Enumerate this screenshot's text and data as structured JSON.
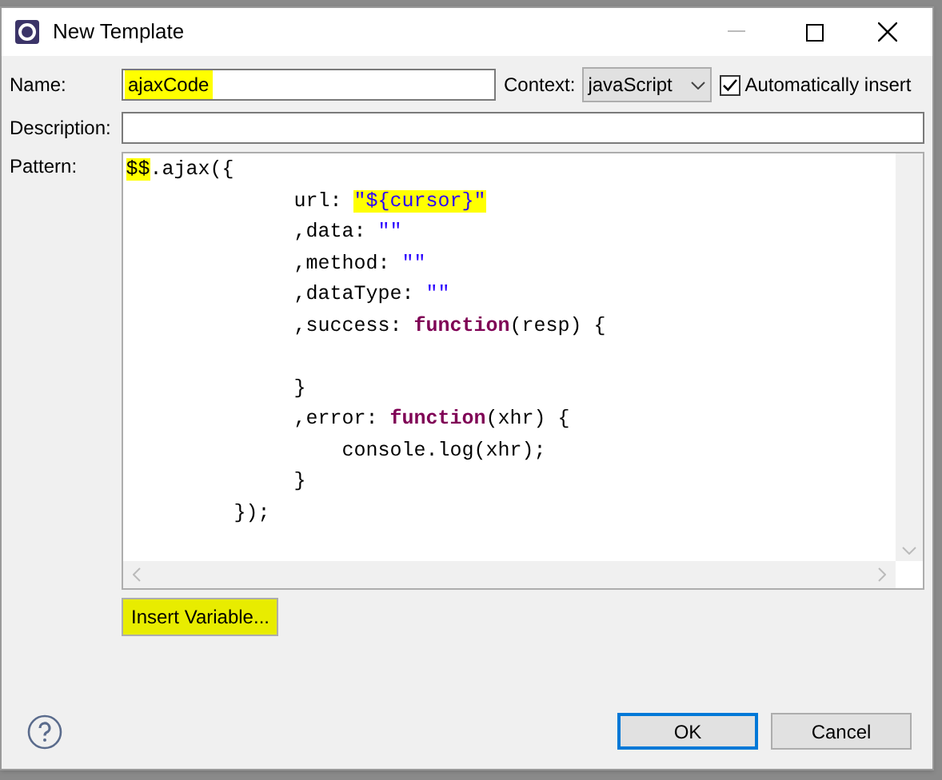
{
  "window": {
    "title": "New Template"
  },
  "name": {
    "label": "Name:",
    "value": "ajaxCode",
    "highlighted": true
  },
  "context": {
    "label": "Context:",
    "value": "javaScript"
  },
  "auto_insert": {
    "label": "Automatically insert",
    "checked": true
  },
  "description": {
    "label": "Description:"
  },
  "pattern": {
    "label": "Pattern:",
    "lines": [
      [
        {
          "text": "$$",
          "kind": "plain",
          "highlighted": true
        },
        {
          "text": ".ajax({",
          "kind": "plain",
          "highlighted": false
        }
      ],
      [
        {
          "text": "              url: ",
          "kind": "plain",
          "highlighted": false
        },
        {
          "text": "\"${cursor}\"",
          "kind": "string",
          "highlighted": true
        }
      ],
      [
        {
          "text": "              ,data: ",
          "kind": "plain",
          "highlighted": false
        },
        {
          "text": "\"\"",
          "kind": "string",
          "highlighted": false
        }
      ],
      [
        {
          "text": "              ,method: ",
          "kind": "plain",
          "highlighted": false
        },
        {
          "text": "\"\"",
          "kind": "string",
          "highlighted": false
        }
      ],
      [
        {
          "text": "              ,dataType: ",
          "kind": "plain",
          "highlighted": false
        },
        {
          "text": "\"\"",
          "kind": "string",
          "highlighted": false
        }
      ],
      [
        {
          "text": "              ,success: ",
          "kind": "plain",
          "highlighted": false
        },
        {
          "text": "function",
          "kind": "keyword",
          "highlighted": false
        },
        {
          "text": "(resp) {",
          "kind": "plain",
          "highlighted": false
        }
      ],
      {
        "kind": "blank"
      },
      [
        {
          "text": "              }",
          "kind": "plain",
          "highlighted": false
        }
      ],
      [
        {
          "text": "              ,error: ",
          "kind": "plain",
          "highlighted": false
        },
        {
          "text": "function",
          "kind": "keyword",
          "highlighted": false
        },
        {
          "text": "(xhr) {",
          "kind": "plain",
          "highlighted": false
        }
      ],
      [
        {
          "text": "                  console.log(xhr);",
          "kind": "plain",
          "highlighted": false
        }
      ],
      [
        {
          "text": "              }",
          "kind": "plain",
          "highlighted": false
        }
      ],
      [
        {
          "text": "         });",
          "kind": "plain",
          "highlighted": false
        }
      ]
    ]
  },
  "insert_variable": {
    "label": "Insert Variable...",
    "highlighted": true
  },
  "buttons": [
    {
      "label": "OK",
      "default": true
    },
    {
      "label": "Cancel",
      "default": false
    }
  ]
}
